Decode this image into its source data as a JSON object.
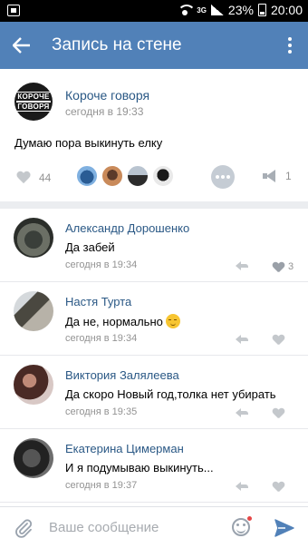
{
  "status_bar": {
    "battery": "23%",
    "time": "20:00",
    "network": "3G"
  },
  "app_bar": {
    "title": "Запись на стене"
  },
  "post": {
    "group_name": "Короче говоря",
    "group_logo_line1": "КОРОЧЕ",
    "group_logo_line2": "ГОВОРЯ",
    "time": "сегодня в 19:33",
    "text": "Думаю пора выкинуть елку",
    "likes": "44",
    "shares": "1"
  },
  "comments": [
    {
      "name": "Александр Дорошенко",
      "text": "Да забей",
      "time": "сегодня в 19:34",
      "likes": "3"
    },
    {
      "name": "Настя Турта",
      "text": "Да не, нормально",
      "time": "сегодня в 19:34",
      "likes": ""
    },
    {
      "name": "Виктория Залялеева",
      "text": "Да скоро Новый год,толка нет убирать",
      "time": "сегодня в 19:35",
      "likes": ""
    },
    {
      "name": "Екатерина Цимерман",
      "text": "И я подумываю выкинуть...",
      "time": "сегодня в 19:37",
      "likes": ""
    }
  ],
  "composer": {
    "placeholder": "Ваше сообщение"
  },
  "colors": {
    "header": "#5181b8",
    "link": "#2a5885",
    "muted": "#939393"
  }
}
